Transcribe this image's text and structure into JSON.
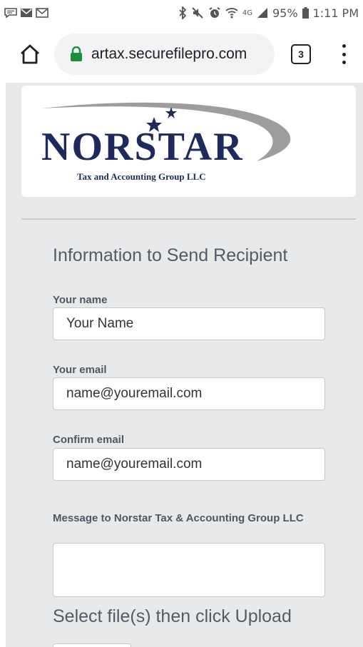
{
  "status_bar": {
    "battery_percent": "95%",
    "time": "1:11 PM",
    "network_label": "4G"
  },
  "browser": {
    "url": "artax.securefilepro.com",
    "tab_count": "3"
  },
  "logo": {
    "brand": "NORSTAR",
    "subtitle": "Tax and Accounting Group LLC"
  },
  "form": {
    "section_title": "Information to Send Recipient",
    "name_label": "Your name",
    "name_placeholder": "Your Name",
    "email_label": "Your email",
    "email_placeholder": "name@youremail.com",
    "confirm_label": "Confirm email",
    "confirm_placeholder": "name@youremail.com",
    "message_label": "Message to Norstar Tax & Accounting Group LLC",
    "upload_title": "Select file(s) then click Upload"
  },
  "colors": {
    "logo_navy": "#1f2a5c",
    "logo_swoosh": "#8c8c8c",
    "page_bg": "#e8e9eb",
    "lock_green": "#1e8e3e"
  }
}
